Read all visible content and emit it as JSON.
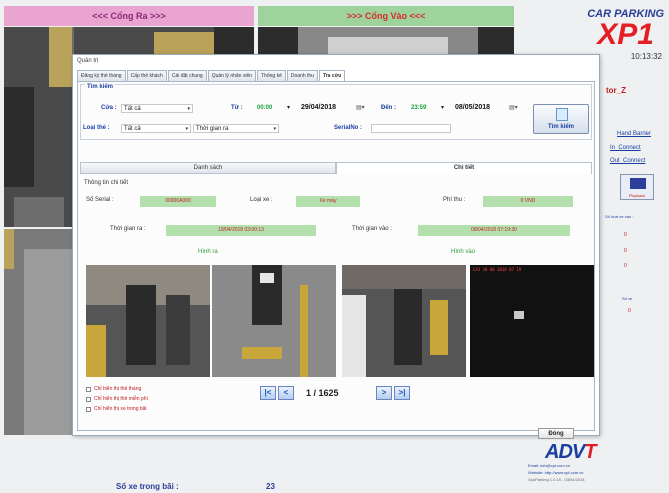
{
  "gates": {
    "exit": "<<<   Cổng Ra   >>>",
    "entry": ">>>   Cổng Vào   <<<"
  },
  "brand": {
    "line1": "CAR PARKING",
    "line2": "XP1",
    "clock": "10:13:32"
  },
  "side_panel": {
    "user": "tor_Z",
    "links": [
      "Hand Barrier",
      "In_Connect",
      "Out_Connect"
    ],
    "button_label": "Playback",
    "note": "Số lượt xe vào :",
    "marks": [
      "0",
      "0",
      "0"
    ],
    "stat_label": "Số xe",
    "stat_value": "0"
  },
  "bottom": {
    "count_label": "Số xe trong bãi :",
    "count_value": "23"
  },
  "window": {
    "title": "Quản trị",
    "tabs": [
      "Đăng ký thẻ tháng",
      "Cấp thẻ khách",
      "Cài đặt chung",
      "Quản lý nhân viên",
      "Thống kê",
      "Doanh thu",
      "Tra cứu"
    ],
    "active_tab": 6
  },
  "filter": {
    "title": "Tìm kiếm",
    "lane_label": "Cửa :",
    "lane_value": "Tất cả",
    "from_label": "Từ :",
    "from_time": "00:00",
    "from_date": "29/04/2018",
    "to_label": "Đến :",
    "to_time": "23:59",
    "to_date": "08/05/2018",
    "card_type_label": "Loại thẻ :",
    "card_type_value": "Tất cả",
    "period_value": "Thời gian ra",
    "serial_label": "SerialNo :",
    "serial_value": "",
    "search_button": "Tìm kiếm"
  },
  "subtabs": [
    "Danh sách",
    "Chi tiết"
  ],
  "active_subtab": 1,
  "detail": {
    "title": "Thông tin chi tiết",
    "serial_label": "Số Serial :",
    "serial_value": "00000A000",
    "type_label": "Loại xe :",
    "type_value": "Xe máy",
    "fee_label": "Phí thu :",
    "fee_value": "0 VND",
    "out_time_label": "Thời gian ra :",
    "out_time_value": "19/04/2018 03:00:13",
    "in_time_label": "Thời gian vào :",
    "in_time_value": "08/04/2018 07:19:30",
    "exit_images_label": "Hình ra",
    "entry_images_label": "Hình vào",
    "photo_stamps": [
      "",
      "",
      "",
      "LA1 18 08 2018 07 19"
    ]
  },
  "checkboxes": [
    "Chỉ hiển thị thẻ tháng",
    "Chỉ hiển thị thẻ miễn phí",
    "Chỉ hiển thị xe trong bãi"
  ],
  "pagination": {
    "first": "|<",
    "prev": "<",
    "page": "1 / 1625",
    "next": ">",
    "last": ">|"
  },
  "footer": {
    "close_button": "Đóng",
    "vendor_a": "ADV",
    "vendor_b": "T",
    "email": "Email: info@xpt.com.vn",
    "website": "Website: http://www.xpt.com.vn",
    "version": "XpoParking 1.0.15 - 03/04/2018"
  }
}
